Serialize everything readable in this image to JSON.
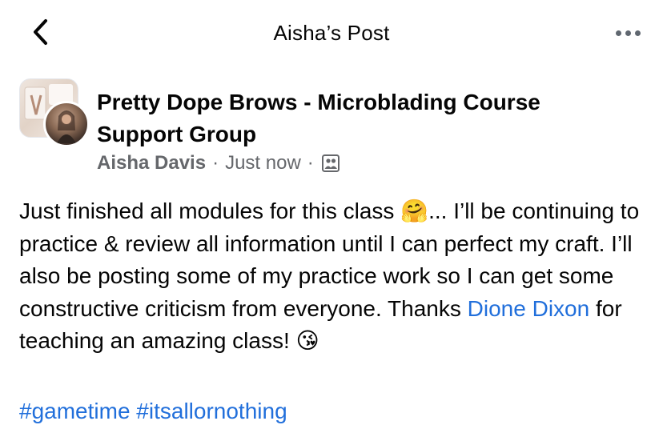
{
  "header": {
    "title": "Aisha’s Post",
    "back_icon": "chevron-left-icon",
    "more_icon": "more-horizontal-icon"
  },
  "post": {
    "group_name": "Pretty Dope Brows - Microblading Course Support Group",
    "author": "Aisha Davis",
    "separator": "·",
    "time": "Just now",
    "audience_icon": "group-members-icon",
    "text_part1": "Just finished all modules for this class ",
    "emoji1": "🤗",
    "text_part2": "... I’ll be continuing to practice & review all information until I can perfect my craft. I’ll also be posting some of my practice work so I can get some constructive criticism from everyone. Thanks ",
    "mention": "Dione Dixon",
    "text_part3": " for teaching an amazing class! ",
    "emoji2": "😘",
    "hashtags": [
      "#gametime",
      "#itsallornothing"
    ]
  },
  "colors": {
    "link": "#216fdb",
    "secondary_text": "#65676b",
    "primary_text": "#050505"
  }
}
